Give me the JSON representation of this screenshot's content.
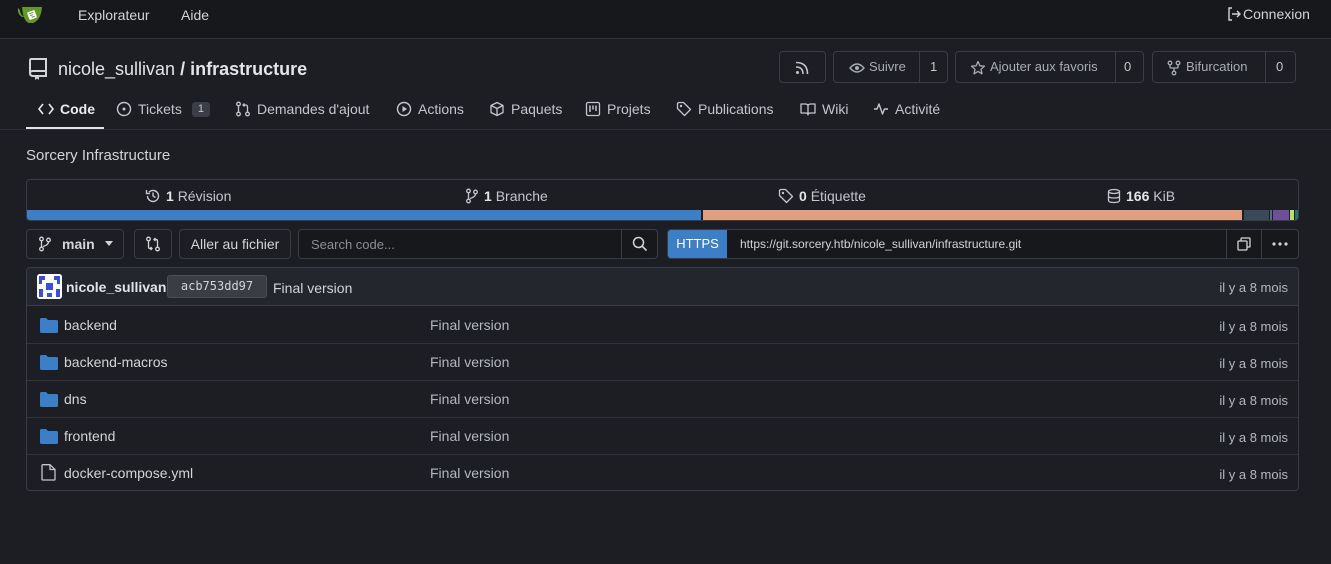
{
  "nav": {
    "explore": "Explorateur",
    "help": "Aide",
    "signin": "Connexion"
  },
  "repo": {
    "owner": "nicole_sullivan",
    "separator": "/",
    "name": "infrastructure",
    "description": "Sorcery Infrastructure",
    "watch_label": "Suivre",
    "watch_count": "1",
    "star_label": "Ajouter aux favoris",
    "star_count": "0",
    "fork_label": "Bifurcation",
    "fork_count": "0"
  },
  "tabs": [
    {
      "label": "Code",
      "icon": "code-icon"
    },
    {
      "label": "Tickets",
      "icon": "issue-icon",
      "count": "1"
    },
    {
      "label": "Demandes d'ajout",
      "icon": "pull-request-icon"
    },
    {
      "label": "Actions",
      "icon": "play-icon"
    },
    {
      "label": "Paquets",
      "icon": "package-icon"
    },
    {
      "label": "Projets",
      "icon": "project-icon"
    },
    {
      "label": "Publications",
      "icon": "tag-icon"
    },
    {
      "label": "Wiki",
      "icon": "book-icon"
    },
    {
      "label": "Activité",
      "icon": "pulse-icon"
    }
  ],
  "stats": {
    "commits_count": "1",
    "commits_label": "Révision",
    "branches_count": "1",
    "branches_label": "Branche",
    "tags_count": "0",
    "tags_label": "Étiquette",
    "size_value": "166",
    "size_unit": "KiB"
  },
  "language_colors": [
    "#3c7fc6",
    "#e09f7f",
    "#3a4a58",
    "#5a6d7f",
    "#6f4f9a",
    "#b9e06c",
    "#2a6f6f"
  ],
  "toolbar": {
    "branch": "main",
    "goto_file": "Aller au fichier",
    "search_placeholder": "Search code...",
    "clone_protocol": "HTTPS",
    "clone_url": "https://git.sorcery.htb/nicole_sullivan/infrastructure.git"
  },
  "commit": {
    "author": "nicole_sullivan",
    "sha": "acb753dd97",
    "message": "Final version",
    "time": "il y a 8 mois"
  },
  "files": [
    {
      "name": "backend",
      "type": "folder",
      "message": "Final version",
      "time": "il y a 8 mois"
    },
    {
      "name": "backend-macros",
      "type": "folder",
      "message": "Final version",
      "time": "il y a 8 mois"
    },
    {
      "name": "dns",
      "type": "folder",
      "message": "Final version",
      "time": "il y a 8 mois"
    },
    {
      "name": "frontend",
      "type": "folder",
      "message": "Final version",
      "time": "il y a 8 mois"
    },
    {
      "name": "docker-compose.yml",
      "type": "file",
      "message": "Final version",
      "time": "il y a 8 mois"
    }
  ]
}
